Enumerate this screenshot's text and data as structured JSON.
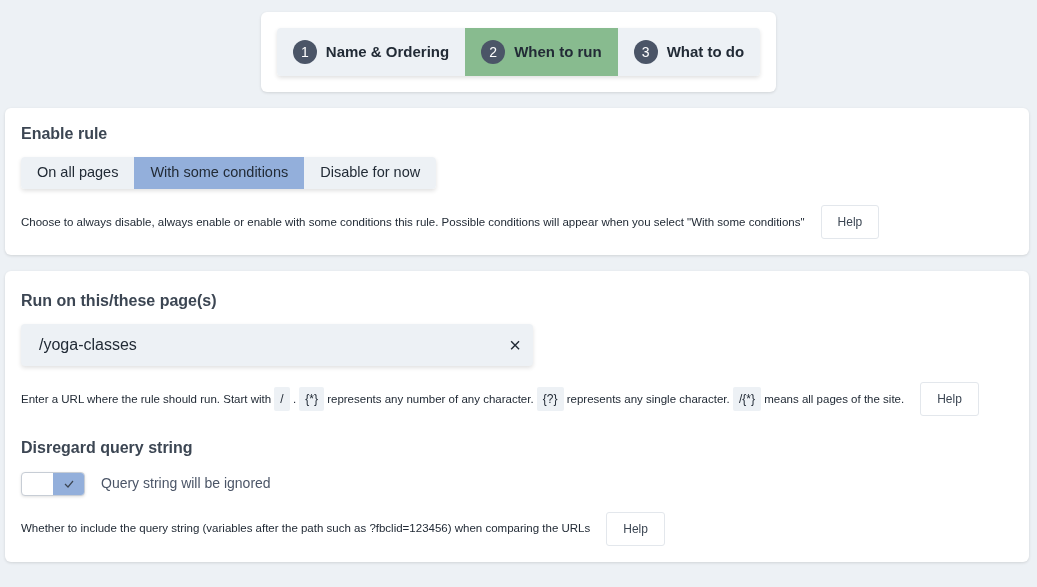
{
  "steps": [
    {
      "number": "1",
      "label": "Name & Ordering",
      "selected": false
    },
    {
      "number": "2",
      "label": "When to run",
      "selected": true
    },
    {
      "number": "3",
      "label": "What to do",
      "selected": false
    }
  ],
  "enable_rule": {
    "title": "Enable rule",
    "options": [
      {
        "label": "On all pages",
        "selected": false
      },
      {
        "label": "With some conditions",
        "selected": true
      },
      {
        "label": "Disable for now",
        "selected": false
      }
    ],
    "description": [
      {
        "kind": "text",
        "text": "Choose to always disable, always enable or enable with some conditions this rule. Possible conditions will appear when you select \"With some conditions\""
      }
    ],
    "help_button": "Help"
  },
  "run_on": {
    "title": "Run on this/these page(s)",
    "url_field": {
      "value": "/yoga-classes",
      "clear": "×"
    },
    "description": [
      {
        "kind": "text",
        "text": "Enter a URL where the rule should run. Start with "
      },
      {
        "kind": "code",
        "text": "/"
      },
      {
        "kind": "text",
        "text": " . "
      },
      {
        "kind": "code",
        "text": "{*}"
      },
      {
        "kind": "text",
        "text": " represents any number of any character. "
      },
      {
        "kind": "code",
        "text": "{?}"
      },
      {
        "kind": "text",
        "text": " represents any single character. "
      },
      {
        "kind": "code",
        "text": "/{*}"
      },
      {
        "kind": "text",
        "text": " means all pages of the site."
      }
    ],
    "help_button": "Help",
    "query": {
      "title": "Disregard query string",
      "on": true,
      "toggle_label": "Query string will be ignored",
      "description": [
        {
          "kind": "text",
          "text": "Whether to include the query string (variables after the path such as ?fbclid=123456) when comparing the URLs"
        }
      ],
      "help_button": "Help"
    }
  }
}
